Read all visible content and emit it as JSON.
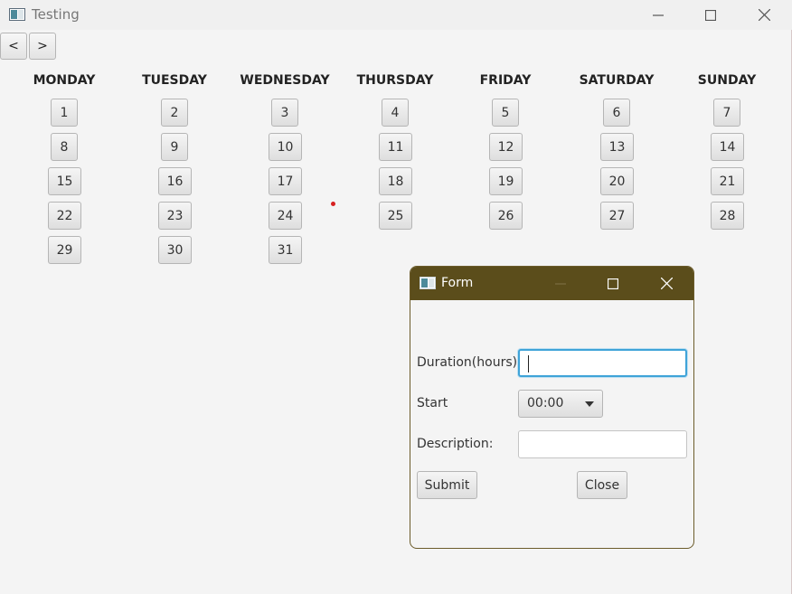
{
  "window": {
    "title": "Testing",
    "minimize_icon": "minimize-icon",
    "maximize_icon": "maximize-icon",
    "close_icon": "close-icon"
  },
  "navigation": {
    "prev_label": "<",
    "next_label": ">"
  },
  "calendar": {
    "days": [
      "MONDAY",
      "TUESDAY",
      "WEDNESDAY",
      "THURSDAY",
      "FRIDAY",
      "SATURDAY",
      "SUNDAY"
    ],
    "weeks": [
      [
        "1",
        "2",
        "3",
        "4",
        "5",
        "6",
        "7"
      ],
      [
        "8",
        "9",
        "10",
        "11",
        "12",
        "13",
        "14"
      ],
      [
        "15",
        "16",
        "17",
        "18",
        "19",
        "20",
        "21"
      ],
      [
        "22",
        "23",
        "24",
        "25",
        "26",
        "27",
        "28"
      ],
      [
        "29",
        "30",
        "31"
      ]
    ]
  },
  "form": {
    "title": "Form",
    "duration_label": "Duration(hours):",
    "duration_value": "",
    "start_label": "Start",
    "start_value": "00:00",
    "description_label": "Description:",
    "description_value": "",
    "submit_label": "Submit",
    "close_label": "Close"
  },
  "colors": {
    "form_titlebar": "#5b4d1b",
    "focus_border": "#3fa3d8",
    "marker_dot": "#d62020"
  }
}
